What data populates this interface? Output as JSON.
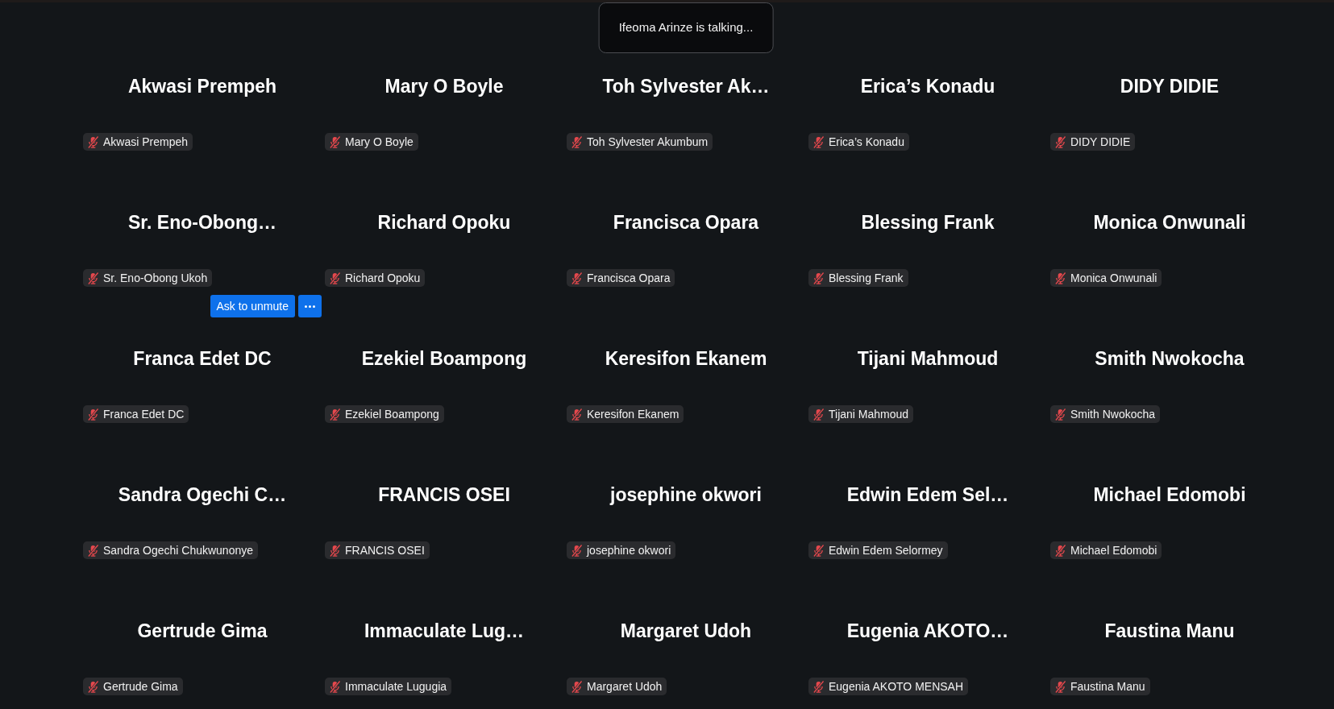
{
  "speaker_banner": {
    "text": "Ifeoma Arinze is talking..."
  },
  "participants": [
    {
      "display_name": "Akwasi Prempeh",
      "name_tag": "Akwasi Prempeh",
      "muted": true
    },
    {
      "display_name": "Mary O Boyle",
      "name_tag": "Mary O Boyle",
      "muted": true
    },
    {
      "display_name": "Toh Sylvester Ak…",
      "name_tag": "Toh Sylvester Akumbum",
      "muted": true
    },
    {
      "display_name": "Erica’s Konadu",
      "name_tag": "Erica’s Konadu",
      "muted": true
    },
    {
      "display_name": "DIDY DIDIE",
      "name_tag": "DIDY DIDIE",
      "muted": true
    },
    {
      "display_name": "Sr. Eno-Obong…",
      "name_tag": "Sr. Eno-Obong Ukoh",
      "muted": true
    },
    {
      "display_name": "Richard Opoku",
      "name_tag": "Richard Opoku",
      "muted": true
    },
    {
      "display_name": "Francisca Opara",
      "name_tag": "Francisca Opara",
      "muted": true
    },
    {
      "display_name": "Blessing Frank",
      "name_tag": "Blessing Frank",
      "muted": true
    },
    {
      "display_name": "Monica Onwunali",
      "name_tag": "Monica Onwunali",
      "muted": true
    },
    {
      "display_name": "Franca Edet DC",
      "name_tag": "Franca Edet DC",
      "muted": true,
      "actions": [
        {
          "kind": "text",
          "label": "Ask to unmute"
        },
        {
          "kind": "more"
        }
      ]
    },
    {
      "display_name": "Ezekiel Boampong",
      "name_tag": "Ezekiel Boampong",
      "muted": true
    },
    {
      "display_name": "Keresifon Ekanem",
      "name_tag": "Keresifon Ekanem",
      "muted": true
    },
    {
      "display_name": "Tijani Mahmoud",
      "name_tag": "Tijani Mahmoud",
      "muted": true
    },
    {
      "display_name": "Smith Nwokocha",
      "name_tag": "Smith Nwokocha",
      "muted": true
    },
    {
      "display_name": "Sandra Ogechi C…",
      "name_tag": "Sandra Ogechi Chukwunonye",
      "muted": true
    },
    {
      "display_name": "FRANCIS OSEI",
      "name_tag": "FRANCIS OSEI",
      "muted": true
    },
    {
      "display_name": "josephine okwori",
      "name_tag": "josephine okwori",
      "muted": true
    },
    {
      "display_name": "Edwin Edem Sel…",
      "name_tag": "Edwin Edem Selormey",
      "muted": true
    },
    {
      "display_name": "Michael Edomobi",
      "name_tag": "Michael Edomobi",
      "muted": true
    },
    {
      "display_name": "Gertrude Gima",
      "name_tag": "Gertrude Gima",
      "muted": true
    },
    {
      "display_name": "Immaculate Lug…",
      "name_tag": "Immaculate Lugugia",
      "muted": true
    },
    {
      "display_name": "Margaret Udoh",
      "name_tag": "Margaret Udoh",
      "muted": true
    },
    {
      "display_name": "Eugenia AKOTO…",
      "name_tag": "Eugenia AKOTO MENSAH",
      "muted": true
    },
    {
      "display_name": "Faustina Manu",
      "name_tag": "Faustina Manu",
      "muted": true
    }
  ]
}
